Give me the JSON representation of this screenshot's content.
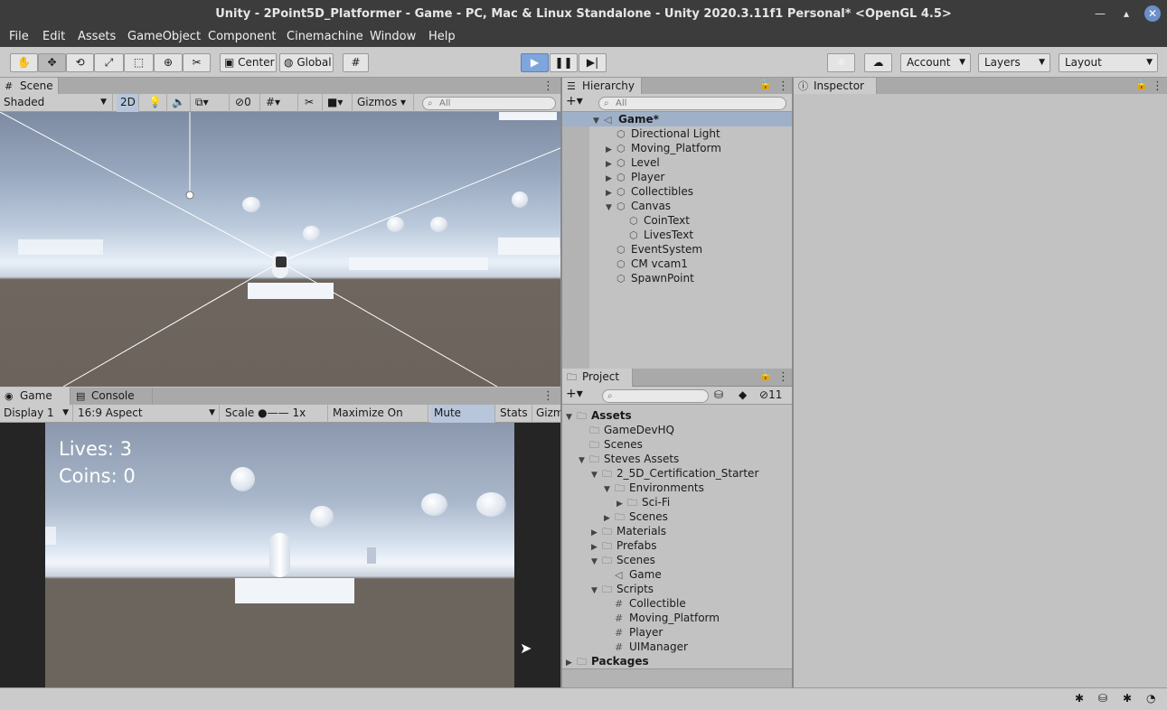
{
  "window": {
    "title": "Unity - 2Point5D_Platformer - Game - PC, Mac & Linux Standalone - Unity 2020.3.11f1 Personal* <OpenGL 4.5>"
  },
  "menu": [
    "File",
    "Edit",
    "Assets",
    "GameObject",
    "Component",
    "Cinemachine",
    "Window",
    "Help"
  ],
  "toolbar": {
    "pivot": "Center",
    "space": "Global",
    "account": "Account",
    "layers": "Layers",
    "layout": "Layout"
  },
  "scene": {
    "tab": "Scene",
    "shading": "Shaded",
    "mode2d": "2D",
    "hidden_count": "0",
    "gizmos": "Gizmos",
    "search_placeholder": "All"
  },
  "game": {
    "tab": "Game",
    "console_tab": "Console",
    "display": "Display 1",
    "aspect": "16:9 Aspect",
    "scale_label": "Scale",
    "scale_value": "1x",
    "maximize": "Maximize On Play",
    "mute": "Mute Audio",
    "stats": "Stats",
    "gizmos_trunc": "Gizm",
    "hud_lives": "Lives: 3",
    "hud_coins": "Coins: 0"
  },
  "hierarchy": {
    "tab": "Hierarchy",
    "search_placeholder": "All",
    "items": [
      {
        "label": "Game*",
        "fold": "▼",
        "icon": "◁",
        "bold": true
      },
      {
        "label": "Directional Light",
        "fold": "",
        "icon": "⬡"
      },
      {
        "label": "Moving_Platform",
        "fold": "▶",
        "icon": "⬡"
      },
      {
        "label": "Level",
        "fold": "▶",
        "icon": "⬡"
      },
      {
        "label": "Player",
        "fold": "▶",
        "icon": "⬡"
      },
      {
        "label": "Collectibles",
        "fold": "▶",
        "icon": "⬡"
      },
      {
        "label": "Canvas",
        "fold": "▼",
        "icon": "⬡"
      },
      {
        "label": "CoinText",
        "fold": "",
        "icon": "⬡"
      },
      {
        "label": "LivesText",
        "fold": "",
        "icon": "⬡"
      },
      {
        "label": "EventSystem",
        "fold": "",
        "icon": "⬡"
      },
      {
        "label": "CM vcam1",
        "fold": "",
        "icon": "⬡"
      },
      {
        "label": "SpawnPoint",
        "fold": "",
        "icon": "⬡"
      }
    ]
  },
  "project": {
    "tab": "Project",
    "hidden_count": "11",
    "items": [
      {
        "label": "Assets",
        "fold": "▼",
        "icon": "🗀",
        "bold": true
      },
      {
        "label": "GameDevHQ",
        "fold": "",
        "icon": "🗀"
      },
      {
        "label": "Scenes",
        "fold": "",
        "icon": "🗀"
      },
      {
        "label": "Steves Assets",
        "fold": "▼",
        "icon": "🗀"
      },
      {
        "label": "2_5D_Certification_Starter",
        "fold": "▼",
        "icon": "🗀"
      },
      {
        "label": "Environments",
        "fold": "▼",
        "icon": "🗀"
      },
      {
        "label": "Sci-Fi",
        "fold": "▶",
        "icon": "🗀"
      },
      {
        "label": "Scenes",
        "fold": "▶",
        "icon": "🗀"
      },
      {
        "label": "Materials",
        "fold": "▶",
        "icon": "🗀"
      },
      {
        "label": "Prefabs",
        "fold": "▶",
        "icon": "🗀"
      },
      {
        "label": "Scenes",
        "fold": "▼",
        "icon": "🗀"
      },
      {
        "label": "Game",
        "fold": "",
        "icon": "◁"
      },
      {
        "label": "Scripts",
        "fold": "▼",
        "icon": "🗀"
      },
      {
        "label": "Collectible",
        "fold": "",
        "icon": "#"
      },
      {
        "label": "Moving_Platform",
        "fold": "",
        "icon": "#"
      },
      {
        "label": "Player",
        "fold": "",
        "icon": "#"
      },
      {
        "label": "UIManager",
        "fold": "",
        "icon": "#"
      },
      {
        "label": "Packages",
        "fold": "▶",
        "icon": "🗀",
        "bold": true
      }
    ]
  },
  "inspector": {
    "tab": "Inspector"
  },
  "icons": {
    "play": "play-icon",
    "pause": "pause-icon",
    "step": "step-icon"
  }
}
